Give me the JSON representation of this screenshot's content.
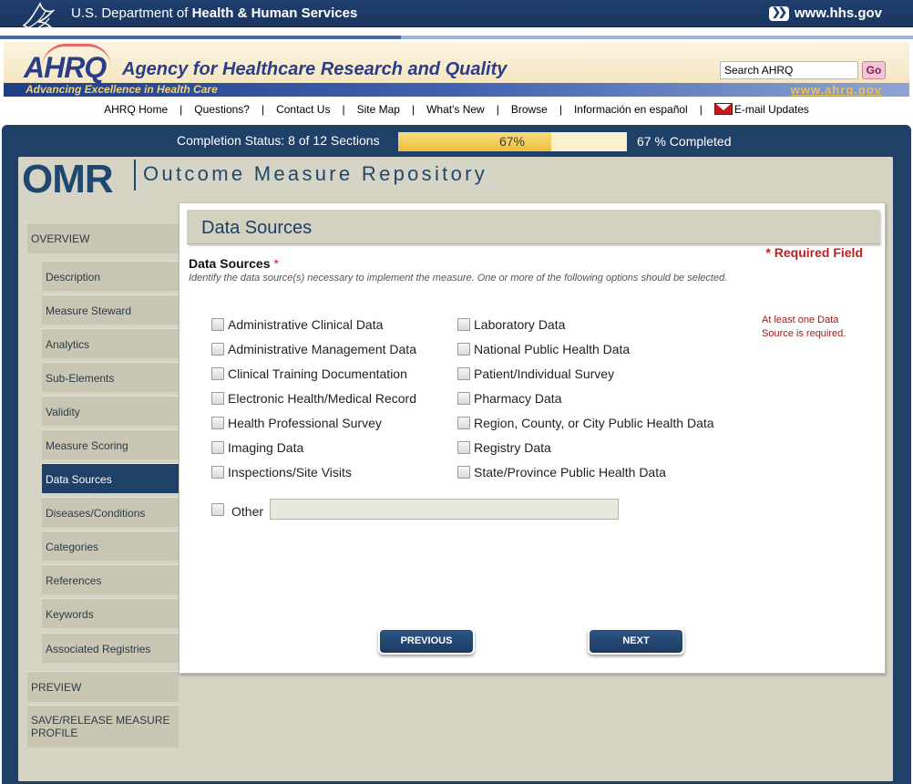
{
  "hhs": {
    "title_prefix": "U.S. Department of ",
    "title_bold": "Health & Human Services",
    "link": "www.hhs.gov"
  },
  "ahrq": {
    "logo": "AHRQ",
    "name": "Agency for Healthcare Research and Quality",
    "tagline": "Advancing Excellence in Health Care",
    "url": "www.ahrq.gov",
    "search_value": "Search AHRQ",
    "go_label": "Go"
  },
  "topnav": [
    "AHRQ Home",
    "Questions?",
    "Contact Us",
    "Site Map",
    "What's New",
    "Browse",
    "Información en español",
    "E-mail Updates"
  ],
  "status": {
    "text": "Completion Status: 8 of 12 Sections",
    "percent_label": "67%",
    "percent_value": 67,
    "completed_text": "67 % Completed"
  },
  "omr": {
    "logo": "OMR",
    "title": "Outcome Measure Repository"
  },
  "sidebar": {
    "overview": "OVERVIEW",
    "items": [
      "Description",
      "Measure Steward",
      "Analytics",
      "Sub-Elements",
      "Validity",
      "Measure Scoring",
      "Data Sources",
      "Diseases/Conditions",
      "Categories",
      "References",
      "Keywords",
      "Associated Registries"
    ],
    "active": "Data Sources",
    "preview": "PREVIEW",
    "save": "SAVE/RELEASE MEASURE PROFILE"
  },
  "content": {
    "heading": "Data Sources",
    "required_field": "* Required Field",
    "field_label": "Data Sources",
    "required_star": "*",
    "help": "Identify the data source(s) necessary to implement the measure. One or more of the following options should be selected.",
    "error": "At least one Data Source is required.",
    "left_options": [
      "Administrative Clinical Data",
      "Administrative Management Data",
      "Clinical Training Documentation",
      "Electronic Health/Medical Record",
      "Health Professional Survey",
      "Imaging Data",
      "Inspections/Site Visits"
    ],
    "right_options": [
      "Laboratory Data",
      "National Public Health Data",
      "Patient/Individual Survey",
      "Pharmacy Data",
      "Region, County, or City Public Health Data",
      "Registry Data",
      "State/Province Public Health Data"
    ],
    "other_label": "Other",
    "other_value": "",
    "previous": "PREVIOUS",
    "next": "NEXT"
  }
}
